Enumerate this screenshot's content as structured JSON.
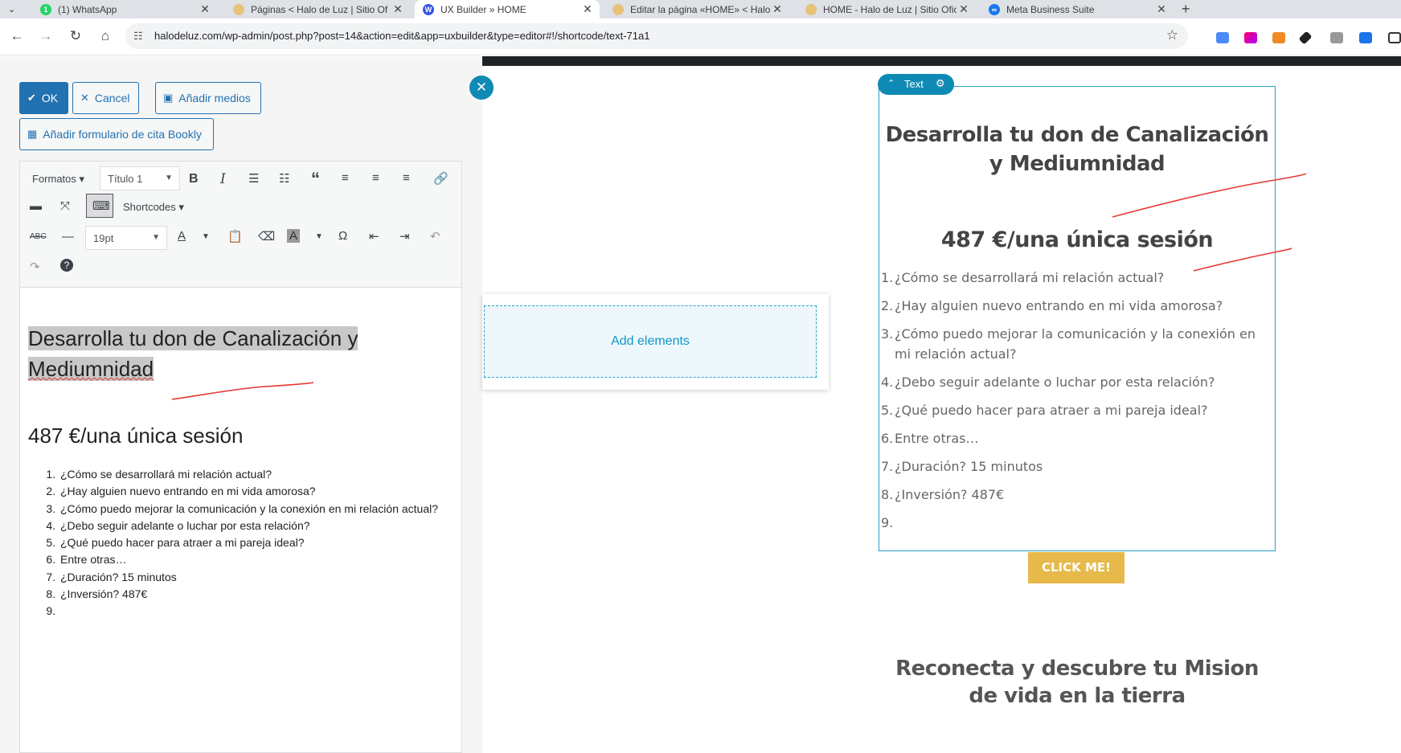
{
  "browser": {
    "tabs": [
      {
        "title": "(1) WhatsApp",
        "fav_color": "#25d366",
        "fav_text": "1"
      },
      {
        "title": "Páginas < Halo de Luz | Sitio Of",
        "fav_color": "#e7c27a",
        "fav_text": ""
      },
      {
        "title": "UX Builder » HOME",
        "fav_color": "#3858e9",
        "fav_text": "W"
      },
      {
        "title": "Editar la página «HOME» < Halo",
        "fav_color": "#e7c27a",
        "fav_text": ""
      },
      {
        "title": "HOME - Halo de Luz | Sitio Ofic",
        "fav_color": "#e7c27a",
        "fav_text": ""
      },
      {
        "title": "Meta Business Suite",
        "fav_color": "#1877f2",
        "fav_text": "∞"
      }
    ],
    "url": "halodeluz.com/wp-admin/post.php?post=14&action=edit&app=uxbuilder&type=editor#!/shortcode/text-71a1"
  },
  "editor": {
    "ok_label": "OK",
    "cancel_label": "Cancel",
    "add_media_label": "Añadir medios",
    "bookly_label": "Añadir formulario de cita Bookly",
    "formats_label": "Formatos",
    "heading_select": "Título 1",
    "shortcodes_label": "Shortcodes",
    "font_size_select": "19pt",
    "content": {
      "heading_line1": "Desarrolla tu don de Canalización y",
      "heading_line2": "Mediumnidad",
      "price": "487 €/una única sesión",
      "items": [
        "¿Cómo se desarrollará mi relación actual?",
        "¿Hay alguien nuevo entrando en mi vida amorosa?",
        "¿Cómo puedo mejorar la comunicación y la conexión en mi relación actual?",
        "¿Debo seguir adelante o luchar por esta relación?",
        "¿Qué puedo hacer para atraer a mi pareja ideal?",
        "Entre otras…",
        "¿Duración? 15 minutos",
        "¿Inversión? 487€",
        ""
      ]
    }
  },
  "canvas": {
    "add_elements_label": "Add elements",
    "text_badge_label": "Text",
    "preview": {
      "title": "Desarrolla tu don de Canalización y Mediumnidad",
      "price": "487 €/una única sesión",
      "items": [
        "¿Cómo se desarrollará mi relación actual?",
        "¿Hay alguien nuevo entrando en mi vida amorosa?",
        "¿Cómo puedo mejorar la comunicación y la conexión en mi relación actual?",
        "¿Debo seguir adelante o luchar por esta relación?",
        "¿Qué puedo hacer para atraer a mi pareja ideal?",
        "Entre otras…",
        "¿Duración? 15 minutos",
        "¿Inversión? 487€",
        ""
      ],
      "button_label": "CLICK ME!",
      "subheading": "Reconecta y descubre tu Mision de vida en la tierra"
    }
  },
  "colors": {
    "wp_blue": "#2271b1",
    "builder_blue": "#0e8ab5",
    "button_gold": "#e6b94a",
    "annotation_red": "#e53935"
  }
}
